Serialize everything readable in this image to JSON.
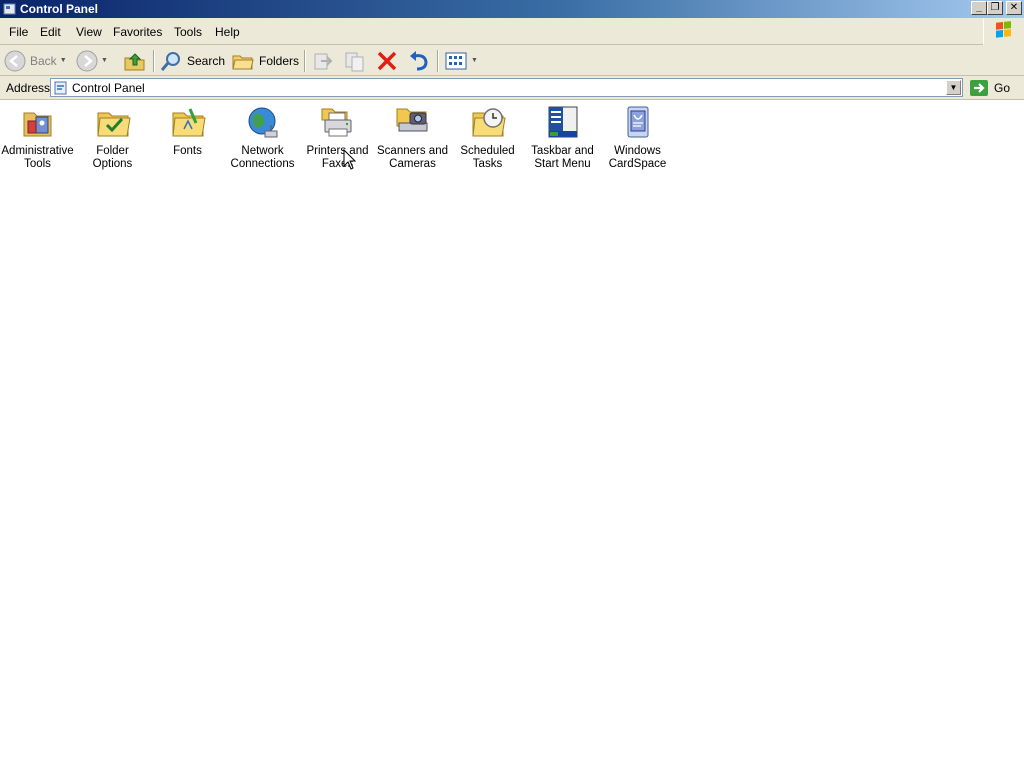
{
  "window": {
    "title": "Control Panel",
    "min_label": "_",
    "max_label": "❐",
    "close_label": "✕"
  },
  "menu": {
    "file": "File",
    "edit": "Edit",
    "view": "View",
    "favorites": "Favorites",
    "tools": "Tools",
    "help": "Help"
  },
  "toolbar": {
    "back_label": "Back",
    "search_label": "Search",
    "folders_label": "Folders"
  },
  "address": {
    "label": "Address",
    "value": "Control Panel",
    "go_label": "Go"
  },
  "items": [
    {
      "label1": "Administrative",
      "label2": "Tools",
      "icon": "administrative-tools-icon"
    },
    {
      "label1": "Folder Options",
      "label2": "",
      "icon": "folder-options-icon"
    },
    {
      "label1": "Fonts",
      "label2": "",
      "icon": "fonts-icon"
    },
    {
      "label1": "Network",
      "label2": "Connections",
      "icon": "network-connections-icon"
    },
    {
      "label1": "Printers and",
      "label2": "Faxes",
      "icon": "printers-faxes-icon"
    },
    {
      "label1": "Scanners and",
      "label2": "Cameras",
      "icon": "scanners-cameras-icon"
    },
    {
      "label1": "Scheduled",
      "label2": "Tasks",
      "icon": "scheduled-tasks-icon"
    },
    {
      "label1": "Taskbar and",
      "label2": "Start Menu",
      "icon": "taskbar-start-menu-icon"
    },
    {
      "label1": "Windows",
      "label2": "CardSpace",
      "icon": "windows-cardspace-icon"
    }
  ]
}
